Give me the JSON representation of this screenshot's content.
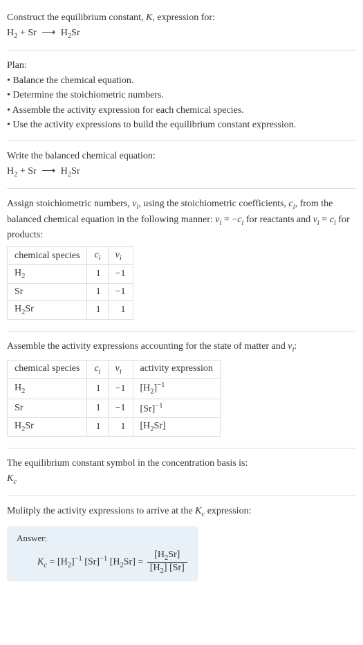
{
  "intro": {
    "line1": "Construct the equilibrium constant, ",
    "line1_k": "K",
    "line1_end": ", expression for:",
    "equation_left": "H",
    "equation_plus": " + Sr ",
    "equation_arrow": "⟶",
    "equation_right": " H",
    "equation_right_end": "Sr"
  },
  "plan": {
    "title": "Plan:",
    "b1": "• Balance the chemical equation.",
    "b2": "• Determine the stoichiometric numbers.",
    "b3": "• Assemble the activity expression for each chemical species.",
    "b4": "• Use the activity expressions to build the equilibrium constant expression."
  },
  "step1": {
    "title": "Write the balanced chemical equation:"
  },
  "step2": {
    "title_a": "Assign stoichiometric numbers, ",
    "nu": "ν",
    "title_b": ", using the stoichiometric coefficients, ",
    "c": "c",
    "title_c": ", from the balanced chemical equation in the following manner: ",
    "eq1": " = −",
    "title_d": " for reactants and ",
    "eq2": " = ",
    "title_e": " for products:"
  },
  "table1": {
    "h1": "chemical species",
    "h2": "c",
    "h3": "ν",
    "rows": [
      {
        "species": "H",
        "sub": "2",
        "c": "1",
        "nu": "−1"
      },
      {
        "species": "Sr",
        "sub": "",
        "c": "1",
        "nu": "−1"
      },
      {
        "species": "H",
        "sub": "2",
        "suffix": "Sr",
        "c": "1",
        "nu": "1"
      }
    ]
  },
  "step3": {
    "title_a": "Assemble the activity expressions accounting for the state of matter and ",
    "title_b": ":"
  },
  "table2": {
    "h1": "chemical species",
    "h2": "c",
    "h3": "ν",
    "h4": "activity expression",
    "rows": [
      {
        "species": "H",
        "sub": "2",
        "c": "1",
        "nu": "−1",
        "act_l": "[H",
        "act_sub": "2",
        "act_r": "]",
        "act_sup": "−1"
      },
      {
        "species": "Sr",
        "c": "1",
        "nu": "−1",
        "act_l": "[Sr]",
        "act_sup": "−1"
      },
      {
        "species": "H",
        "sub": "2",
        "suffix": "Sr",
        "c": "1",
        "nu": "1",
        "act_l": "[H",
        "act_sub": "2",
        "act_r": "Sr]"
      }
    ]
  },
  "step4": {
    "line": "The equilibrium constant symbol in the concentration basis is:",
    "kc": "K",
    "kc_sub": "c"
  },
  "step5": {
    "line_a": "Mulitply the activity expressions to arrive at the ",
    "line_b": " expression:"
  },
  "answer": {
    "label": "Answer:",
    "kc": "K",
    "eq": " = [H",
    "part2": "]",
    "part3": " [Sr]",
    "part4": " [H",
    "part5": "Sr] = ",
    "frac_num_a": "[H",
    "frac_num_b": "Sr]",
    "frac_den_a": "[H",
    "frac_den_b": "] [Sr]"
  }
}
